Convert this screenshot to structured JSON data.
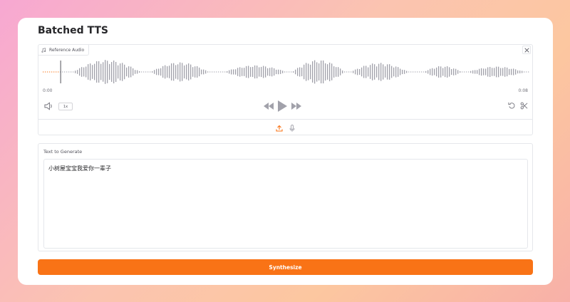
{
  "page": {
    "title": "Batched TTS"
  },
  "audio": {
    "label": "Reference Audio",
    "time_start": "0:00",
    "time_end": "0:08",
    "playback_rate": "1x",
    "progress": 0
  },
  "text_panel": {
    "label": "Text to Generate",
    "value": "小树屋宝宝我爱你一辈子"
  },
  "synthesize_button": {
    "label": "Synthesize"
  },
  "icons": {
    "audio_label": "music-icon",
    "close": "close-icon",
    "volume": "volume-icon",
    "rewind": "rewind-icon",
    "play": "play-icon",
    "forward": "fast-forward-icon",
    "undo": "undo-icon",
    "trim": "scissors-icon",
    "upload": "upload-icon",
    "mic": "microphone-icon"
  },
  "colors": {
    "accent": "#f97316",
    "wave_bar": "#a1a1aa",
    "wave_cursor": "#f97316"
  }
}
